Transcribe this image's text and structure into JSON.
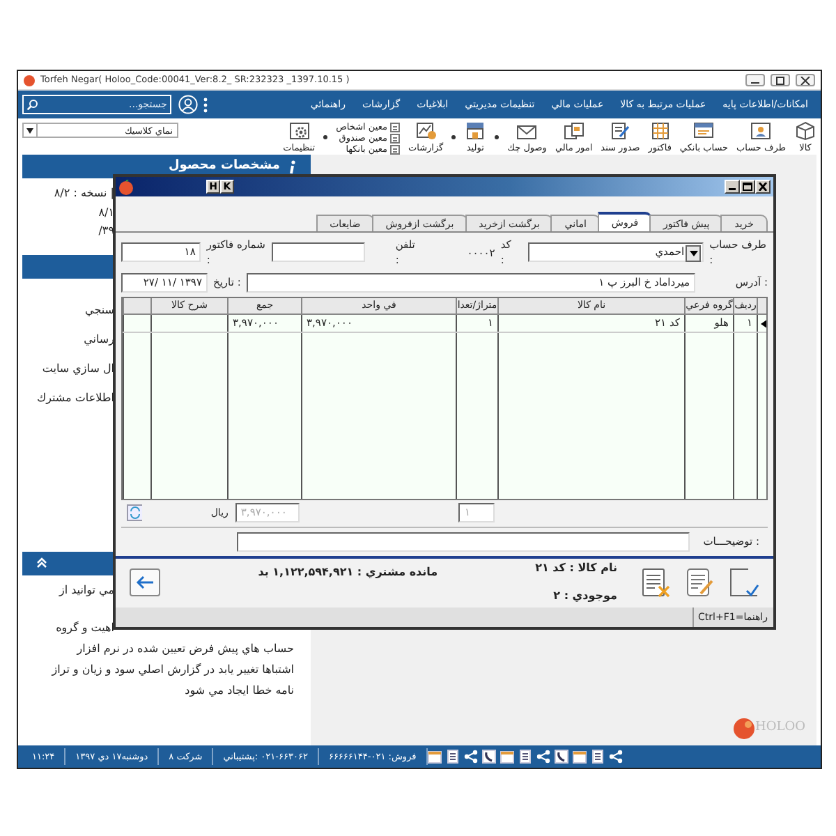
{
  "app_window": {
    "title": "Torfeh Negar( Holoo_Code:00041_Ver:8.2_ SR:232323 _1397.10.15 )"
  },
  "menu_bar": {
    "search": {
      "placeholder": "جستجو..."
    },
    "items": [
      "امكانات/اطلاعات پايه",
      "عمليات مرتبط به كالا",
      "عمليات مالي",
      "تنظيمات مديريتي",
      "ابلاغيات",
      "گزارشات",
      "راهنمائي"
    ]
  },
  "toolbar": {
    "view_select": {
      "value": "نماي كلاسيك"
    },
    "items": [
      {
        "kind": "button",
        "label": "كالا"
      },
      {
        "kind": "button",
        "label": "طرف حساب"
      },
      {
        "kind": "button",
        "label": "حساب بانكي"
      },
      {
        "kind": "button",
        "label": "فاكتور"
      },
      {
        "kind": "button",
        "label": "صدور سند"
      },
      {
        "kind": "button",
        "label": "امور مالي"
      },
      {
        "kind": "button",
        "label": "وصول چك"
      },
      {
        "kind": "separator"
      },
      {
        "kind": "button",
        "label": "توليد"
      },
      {
        "kind": "separator"
      },
      {
        "kind": "button",
        "label": "گزارشات"
      },
      {
        "kind": "stack",
        "entries": [
          "معين اشخاص",
          "معين صندوق",
          "معين بانكها"
        ]
      },
      {
        "kind": "separator"
      },
      {
        "kind": "button",
        "label": "تنظيمات"
      }
    ]
  },
  "side_panel": {
    "sections": [
      {
        "kind": "info",
        "title": "مشخصات محصول",
        "lines": [
          {
            "kind": "fragment",
            "text": "| نسخه : ۸/۲"
          },
          {
            "kind": "fragment",
            "text": "۸/۱"
          },
          {
            "kind": "fragment",
            "text": "۳۹/"
          }
        ]
      },
      {
        "kind": "plain",
        "lines": [
          {
            "kind": "fragment",
            "text": "سنجي"
          },
          {
            "kind": "fragment",
            "text": "رساني"
          },
          {
            "kind": "fragment",
            "text": "ال سازي سايت"
          },
          {
            "kind": "fragment",
            "text": "اطلاعات مشترك"
          }
        ]
      },
      {
        "kind": "collapse",
        "lines": [
          {
            "kind": "fragment",
            "text": "مي توانيد از"
          },
          {
            "kind": "fragment",
            "text": "اهيت و گروه"
          },
          {
            "kind": "full",
            "text": "حساب هاي پيش فرض تعيين شده در نرم افزار"
          },
          {
            "kind": "full",
            "text": "اشتباها تغيير يابد در گزارش اصلي سود و زيان و تراز"
          },
          {
            "kind": "full",
            "text": "نامه خطا ايجاد مي شود"
          }
        ]
      }
    ]
  },
  "logo": {
    "text": "HOLOO"
  },
  "status_bar": {
    "items": [
      "فروش: ۰۲۱-۶۶۶۶۶۱۴۴",
      "۰۲۱-۶۶۳۰۶۲ :پشتيباني",
      "شركت ۸",
      "دوشنبه۱۷ دي ۱۳۹۷",
      "۱۱:۲۴"
    ]
  },
  "dialog": {
    "title_buttons": [
      "K",
      "H"
    ],
    "tabs": [
      {
        "label": "خريد",
        "selected": false
      },
      {
        "label": "پيش فاكتور",
        "selected": false
      },
      {
        "label": "فروش",
        "selected": true
      },
      {
        "label": "اماني",
        "selected": false
      },
      {
        "label": "برگشت ازخريد",
        "selected": false
      },
      {
        "label": "برگشت ازفروش",
        "selected": false
      },
      {
        "label": "ضايعات",
        "selected": false
      }
    ],
    "account_label": "طرف حساب :",
    "account_value": "احمدي",
    "code_label": "كد :",
    "code_value": "۰۰۰۰۲",
    "phone_label": "تلفن :",
    "invoice_no_label": "شماره فاكتور :",
    "invoice_no": "۱۸",
    "address_label": "آدرس :",
    "address": "ميرداماد خ البرز پ ۱",
    "date_label": "تاريخ :",
    "date": "۱۳۹۷ /۱۱ /۲۷",
    "table": {
      "columns": [
        "رديف",
        "گروه فرعي",
        "نام كالا",
        "متراژ/تعدا",
        "في واحد",
        "جمع",
        "شرح كالا"
      ],
      "rows": [
        {
          "current": true,
          "cells": [
            "۱",
            "هلو",
            "كد ۲۱",
            "۱",
            "۳,۹۷۰,۰۰۰",
            "۳,۹۷۰,۰۰۰",
            null
          ]
        }
      ]
    },
    "total_quantity": "۱",
    "total_amount": "۳,۹۷۰,۰۰۰",
    "currency": "ريال",
    "notes_label": "توضيحـــات :",
    "item_name": "نام كالا : كد ۲۱",
    "stock": "موجودي : ۲",
    "customer_balance": "مانده مشتري : ۱,۱۲۲,۵۹۴,۹۲۱ بد",
    "help_hint": "Ctrl+F1=راهنما"
  }
}
